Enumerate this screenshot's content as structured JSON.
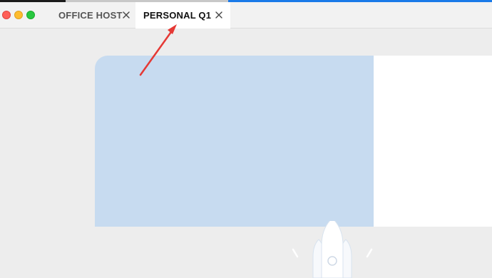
{
  "window": {
    "controls": {
      "close_icon": "close-dot-icon",
      "minimize_icon": "minimize-dot-icon",
      "maximize_icon": "maximize-dot-icon"
    }
  },
  "tabs": [
    {
      "label": "OFFICE HOST",
      "active": false
    },
    {
      "label": "PERSONAL Q1",
      "active": true
    }
  ],
  "colors": {
    "accent": "#1a7ae8",
    "annotation_arrow": "#e53935",
    "illustration_bg": "#c7dbf0"
  },
  "illustration": {
    "icon": "rocket-icon"
  },
  "annotation": {
    "icon": "arrow-pointer-icon"
  }
}
